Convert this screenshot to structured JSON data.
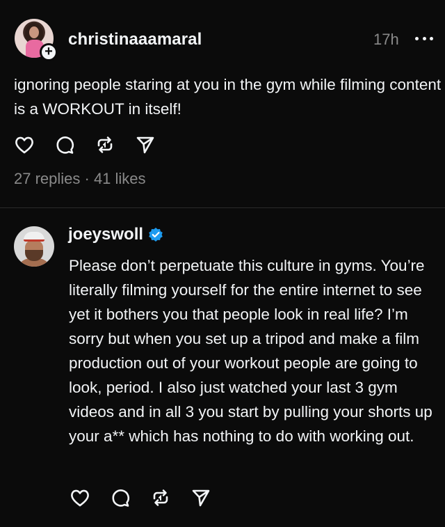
{
  "post": {
    "username": "christinaaamaral",
    "time": "17h",
    "text": "ignoring people staring at you in the gym while filming content is a WORKOUT in itself!",
    "stats": "27 replies · 41 likes",
    "avatar_badge": "+"
  },
  "reply": {
    "username": "joeyswoll",
    "verified": true,
    "text": "Please don’t perpetuate this culture in gyms. You’re literally filming yourself for the entire internet to see yet it bothers you that people look in real life? I’m sorry but when you set up a tripod and make a film production out of your workout people are going to look, period. I also just watched your last 3 gym videos and in all 3 you start by pulling your shorts up your a** which has nothing to do with working out."
  },
  "icons": {
    "like": "heart-icon",
    "comment": "comment-icon",
    "repost": "repost-icon",
    "share": "share-icon",
    "more": "more-icon",
    "verified": "verified-badge-icon"
  },
  "colors": {
    "background": "#0b0b0b",
    "text": "#f3f5f7",
    "muted": "#8a8a8a",
    "verified": "#1d9bf0"
  }
}
